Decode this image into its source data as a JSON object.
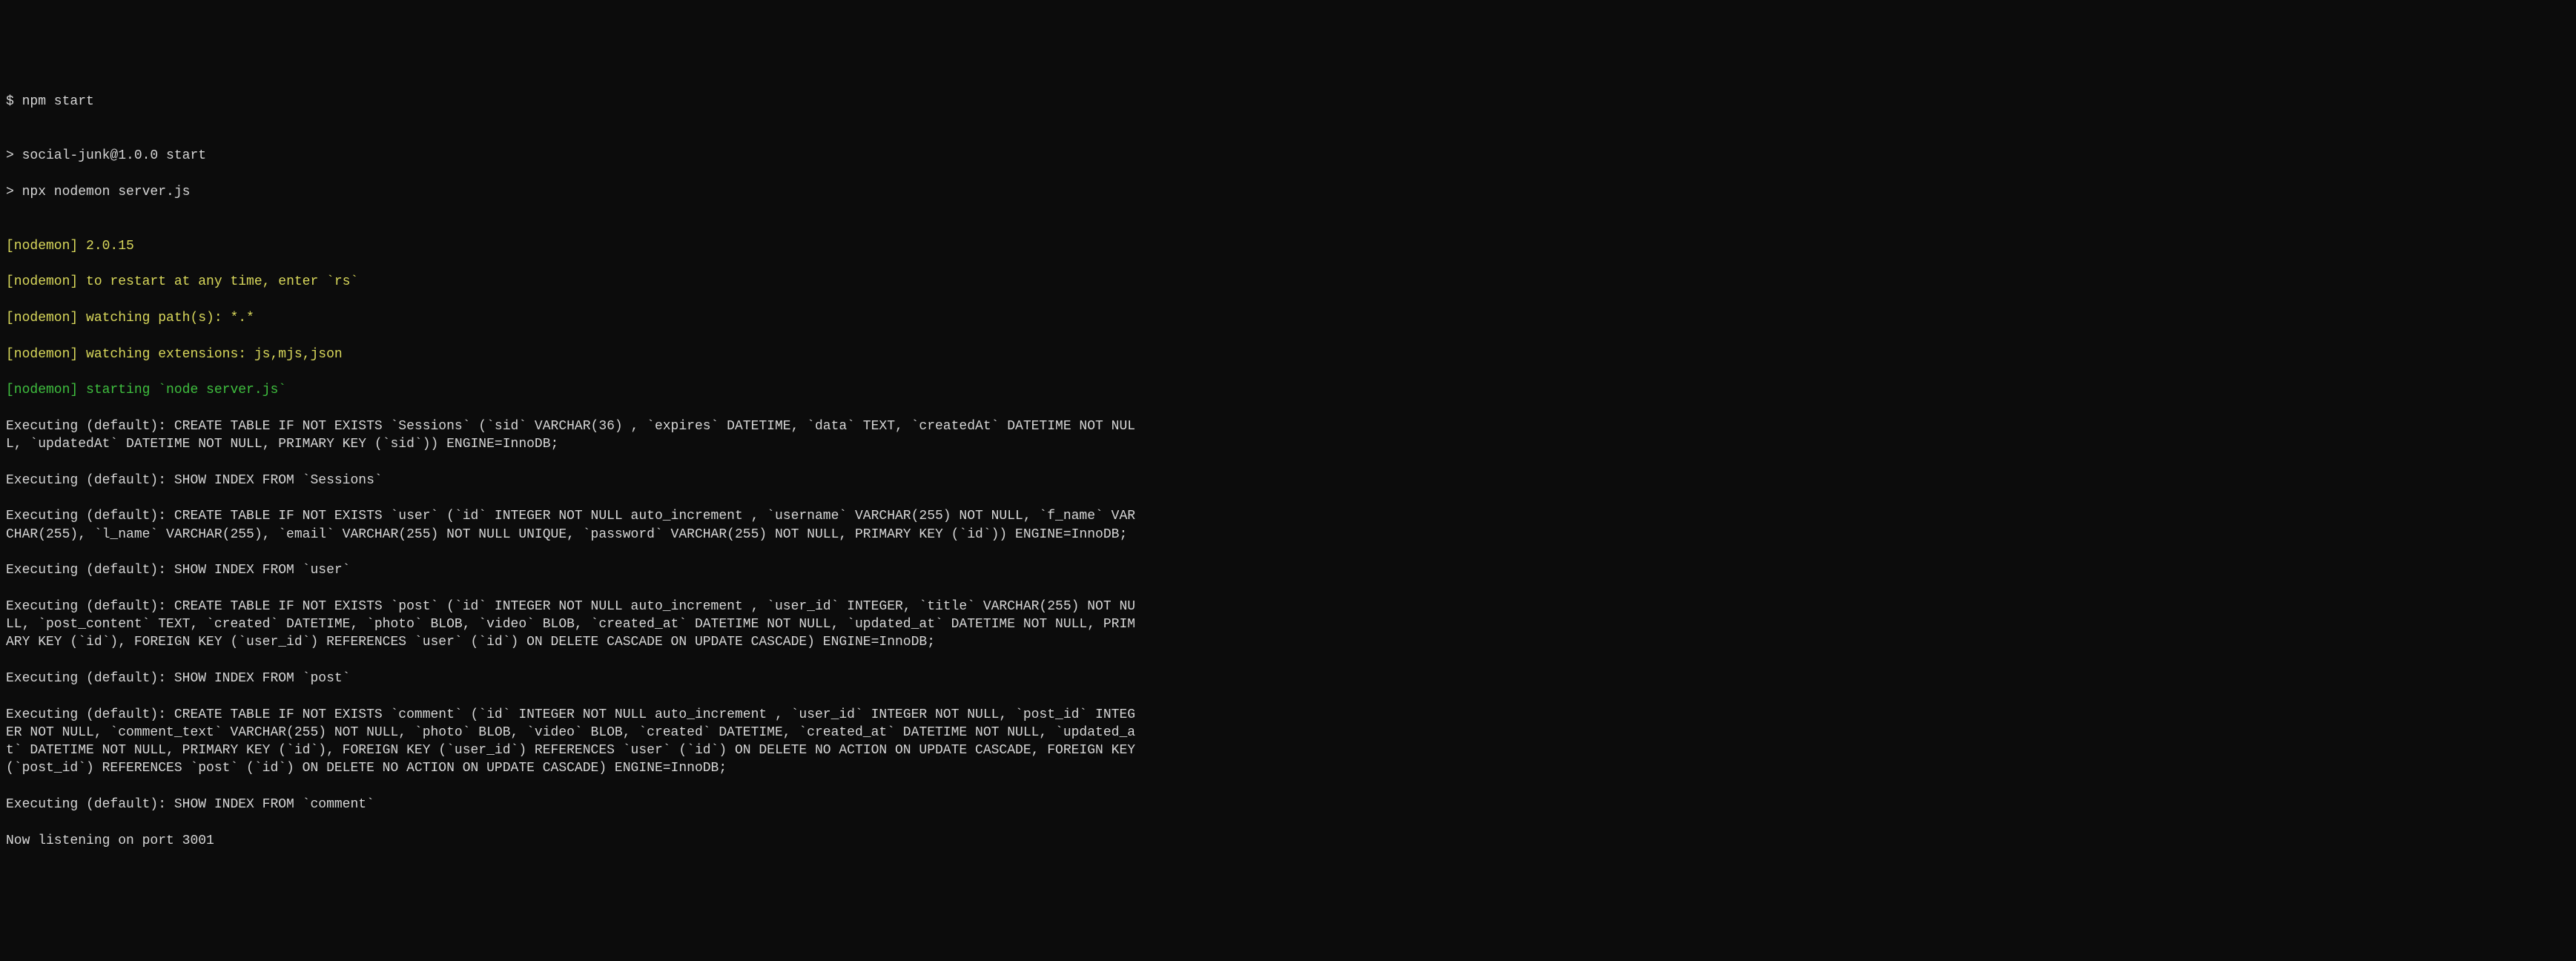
{
  "lines": {
    "prompt": "$ npm start",
    "blank1": "",
    "npm1": "> social-junk@1.0.0 start",
    "npm2": "> npx nodemon server.js",
    "blank2": "",
    "nodemon_tag": "[nodemon]",
    "nodemon_version": " 2.0.15",
    "nodemon_restart": " to restart at any time, enter `rs`",
    "nodemon_paths": " watching path(s): *.*",
    "nodemon_ext": " watching extensions: js,mjs,json",
    "nodemon_start": " starting `node server.js`",
    "exec1": "Executing (default): CREATE TABLE IF NOT EXISTS `Sessions` (`sid` VARCHAR(36) , `expires` DATETIME, `data` TEXT, `createdAt` DATETIME NOT NULL, `updatedAt` DATETIME NOT NULL, PRIMARY KEY (`sid`)) ENGINE=InnoDB;",
    "exec2": "Executing (default): SHOW INDEX FROM `Sessions`",
    "exec3": "Executing (default): CREATE TABLE IF NOT EXISTS `user` (`id` INTEGER NOT NULL auto_increment , `username` VARCHAR(255) NOT NULL, `f_name` VARCHAR(255), `l_name` VARCHAR(255), `email` VARCHAR(255) NOT NULL UNIQUE, `password` VARCHAR(255) NOT NULL, PRIMARY KEY (`id`)) ENGINE=InnoDB;",
    "exec4": "Executing (default): SHOW INDEX FROM `user`",
    "exec5": "Executing (default): CREATE TABLE IF NOT EXISTS `post` (`id` INTEGER NOT NULL auto_increment , `user_id` INTEGER, `title` VARCHAR(255) NOT NULL, `post_content` TEXT, `created` DATETIME, `photo` BLOB, `video` BLOB, `created_at` DATETIME NOT NULL, `updated_at` DATETIME NOT NULL, PRIMARY KEY (`id`), FOREIGN KEY (`user_id`) REFERENCES `user` (`id`) ON DELETE CASCADE ON UPDATE CASCADE) ENGINE=InnoDB;",
    "exec6": "Executing (default): SHOW INDEX FROM `post`",
    "exec7": "Executing (default): CREATE TABLE IF NOT EXISTS `comment` (`id` INTEGER NOT NULL auto_increment , `user_id` INTEGER NOT NULL, `post_id` INTEGER NOT NULL, `comment_text` VARCHAR(255) NOT NULL, `photo` BLOB, `video` BLOB, `created` DATETIME, `created_at` DATETIME NOT NULL, `updated_at` DATETIME NOT NULL, PRIMARY KEY (`id`), FOREIGN KEY (`user_id`) REFERENCES `user` (`id`) ON DELETE NO ACTION ON UPDATE CASCADE, FOREIGN KEY (`post_id`) REFERENCES `post` (`id`) ON DELETE NO ACTION ON UPDATE CASCADE) ENGINE=InnoDB;",
    "exec8": "Executing (default): SHOW INDEX FROM `comment`",
    "listening": "Now listening on port 3001"
  }
}
